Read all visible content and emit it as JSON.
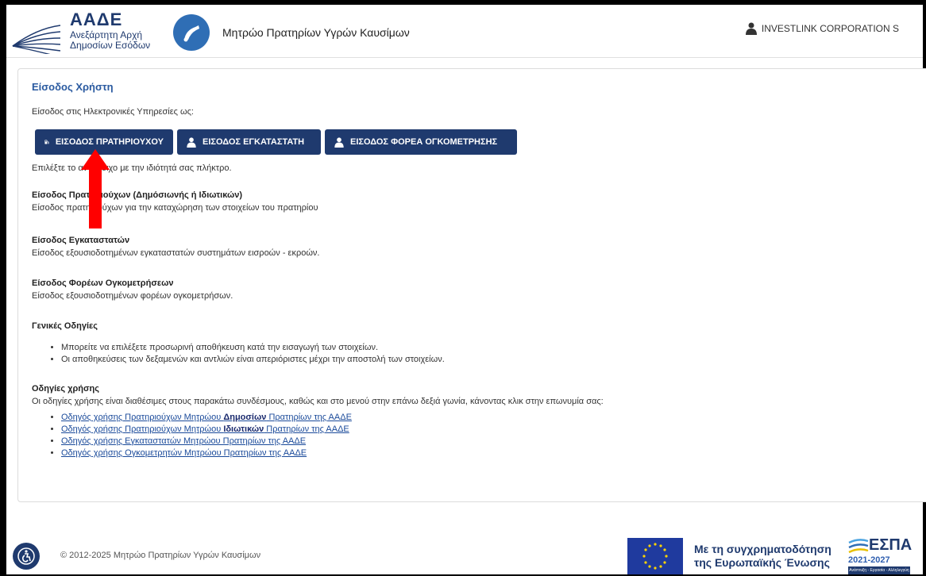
{
  "header": {
    "logo_title": "ΑΑΔΕ",
    "logo_sub_line1": "Ανεξάρτητη Αρχή",
    "logo_sub_line2": "Δημοσίων Εσόδων",
    "app_title": "Μητρώο Πρατηρίων Υγρών Καυσίμων",
    "user_name": "INVESTLINK CORPORATION S"
  },
  "main": {
    "section_title": "Είσοδος Χρήστη",
    "intro": "Είσοδος στις Ηλεκτρονικές Υπηρεσίες ως:",
    "buttons": {
      "owner": "ΕΙΣΟΔΟΣ ΠΡΑΤΗΡΙΟΥΧΟΥ",
      "installer": "ΕΙΣΟΔΟΣ ΕΓΚΑΤΑΣΤΑΤΗ",
      "metering": "ΕΙΣΟΔΟΣ ΦΟΡΕΑ ΟΓΚΟΜΕΤΡΗΣΗΣ"
    },
    "choose_text": "Επιλέξτε το αντίστοιχο με την ιδιότητά σας πλήκτρο.",
    "blocks": [
      {
        "heading": "Είσοδος Πρατηριούχων (Δημόσιωνής ή Ιδιωτικών)",
        "text": "Είσοδος πρατηριούχων για την καταχώρηση των στοιχείων του πρατηρίου"
      },
      {
        "heading": "Είσοδος Εγκαταστατών",
        "text": "Είσοδος εξουσιοδοτημένων εγκαταστατών συστημάτων εισροών - εκροών."
      },
      {
        "heading": "Είσοδος Φορέων Ογκομετρήσεων",
        "text": "Είσοδος εξουσιοδοτημένων φορέων ογκομετρήσων."
      }
    ],
    "general_heading": "Γενικές Οδηγίες",
    "general_items": [
      "Μπορείτε να επιλέξετε προσωρινή αποθήκευση κατά την εισαγωγή των στοιχείων.",
      "Οι αποθηκεύσεις των δεξαμενών και αντλιών είναι απεριόριστες μέχρι την αποστολή των στοιχείων."
    ],
    "usage_heading": "Οδηγίες χρήσης",
    "usage_text": "Οι οδηγίες χρήσης είναι διαθέσιμες στους παρακάτω συνδέσμους, καθώς και στο μενού στην επάνω δεξιά γωνία, κάνοντας κλικ στην επωνυμία σας:",
    "links": {
      "l1_pre": "Οδηγός χρήσης Πρατηριούχων Μητρώου ",
      "l1_bold": "Δημοσίων",
      "l1_post": " Πρατηρίων της ΑΑΔΕ",
      "l2_pre": "Οδηγός χρήσης Πρατηριούχων Μητρώου ",
      "l2_bold": "Ιδιωτικών",
      "l2_post": " Πρατηρίων της ΑΑΔΕ",
      "l3": "Οδηγός χρήσης Εγκαταστατών Μητρώου Πρατηρίων της ΑΑΔΕ",
      "l4": "Οδηγός χρήσης Ογκομετρητών Μητρώου Πρατηρίων της ΑΑΔΕ"
    }
  },
  "footer": {
    "copyright": "© 2012-2025 Μητρώο Πρατηρίων Υγρών Καυσίμων",
    "cofund_line1": "Με τη συγχρηματοδότηση",
    "cofund_line2": "της Ευρωπαϊκής Ένωσης",
    "espa_title": "ΕΣΠΑ",
    "espa_years": "2021-2027",
    "espa_tag": "Ανάπτυξη - Εργασία - Αλληλεγγύη"
  },
  "colors": {
    "brand": "#1f3a6e",
    "link": "#1a4a9a",
    "accent_arrow": "#ff0000"
  }
}
